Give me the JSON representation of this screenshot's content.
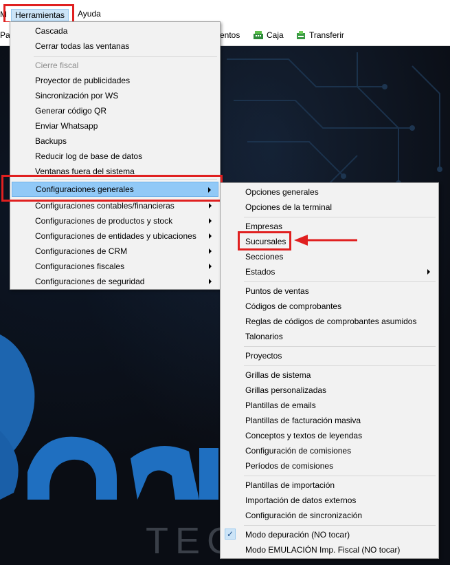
{
  "menubar": {
    "cut_label": "M",
    "items": [
      {
        "label": "Herramientas"
      },
      {
        "label": "Ayuda"
      }
    ]
  },
  "toolbar": {
    "cut_left": "Pag",
    "cut_mid": "entos",
    "caja": "Caja",
    "transferir": "Transferir"
  },
  "herramientas_menu": {
    "items": [
      {
        "label": "Cascada"
      },
      {
        "label": "Cerrar todas las ventanas"
      },
      {
        "label": "Cierre fiscal"
      },
      {
        "label": "Proyector de publicidades"
      },
      {
        "label": "Sincronización por WS"
      },
      {
        "label": "Generar código QR"
      },
      {
        "label": "Enviar Whatsapp"
      },
      {
        "label": "Backups"
      },
      {
        "label": "Reducir log de base de datos"
      },
      {
        "label": "Ventanas fuera del sistema"
      },
      {
        "label": "Configuraciones generales"
      },
      {
        "label": "Configuraciones contables/financieras"
      },
      {
        "label": "Configuraciones de productos y stock"
      },
      {
        "label": "Configuraciones de entidades y ubicaciones"
      },
      {
        "label": "Configuraciones de CRM"
      },
      {
        "label": "Configuraciones fiscales"
      },
      {
        "label": "Configuraciones de seguridad"
      }
    ]
  },
  "config_submenu": {
    "items": [
      {
        "label": "Opciones generales"
      },
      {
        "label": "Opciones de la terminal"
      },
      {
        "label": "Empresas"
      },
      {
        "label": "Sucursales"
      },
      {
        "label": "Secciones"
      },
      {
        "label": "Estados"
      },
      {
        "label": "Puntos de ventas"
      },
      {
        "label": "Códigos de comprobantes"
      },
      {
        "label": "Reglas de códigos de comprobantes asumidos"
      },
      {
        "label": "Talonarios"
      },
      {
        "label": "Proyectos"
      },
      {
        "label": "Grillas de sistema"
      },
      {
        "label": "Grillas personalizadas"
      },
      {
        "label": "Plantillas de emails"
      },
      {
        "label": "Plantillas de facturación masiva"
      },
      {
        "label": "Conceptos y textos de leyendas"
      },
      {
        "label": "Configuración de comisiones"
      },
      {
        "label": "Períodos de comisiones"
      },
      {
        "label": "Plantillas de importación"
      },
      {
        "label": "Importación de datos externos"
      },
      {
        "label": "Configuración de sincronización"
      },
      {
        "label": "Modo depuración (NO tocar)"
      },
      {
        "label": "Modo EMULACIÓN Imp. Fiscal (NO tocar)"
      }
    ]
  },
  "background": {
    "logo_text": "TEC"
  },
  "colors": {
    "annotation_red": "#e02020",
    "selection_blue": "#91c9f7"
  }
}
